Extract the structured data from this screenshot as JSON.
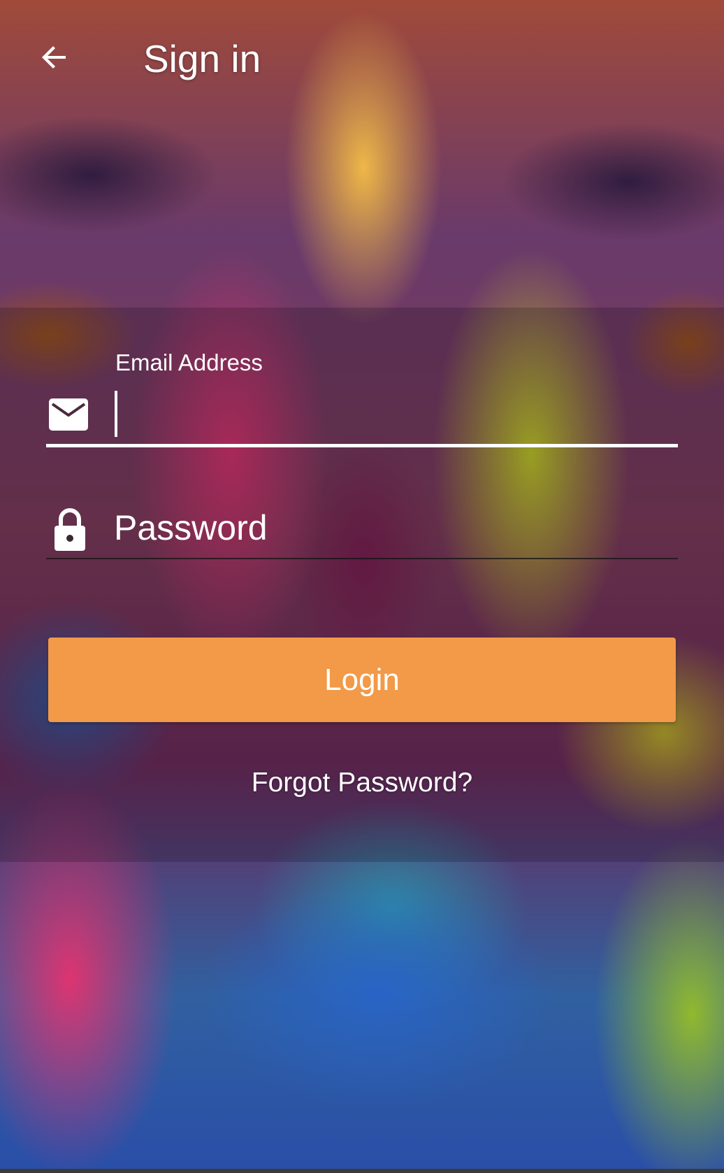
{
  "appbar": {
    "title": "Sign in",
    "back_icon": "arrow-back-icon"
  },
  "form": {
    "email": {
      "label": "Email Address",
      "value": "",
      "icon": "envelope-icon"
    },
    "password": {
      "placeholder": "Password",
      "value": "",
      "icon": "lock-icon"
    },
    "login_label": "Login",
    "forgot_label": "Forgot Password?"
  },
  "colors": {
    "accent": "#f29a48",
    "text": "#ffffff"
  }
}
